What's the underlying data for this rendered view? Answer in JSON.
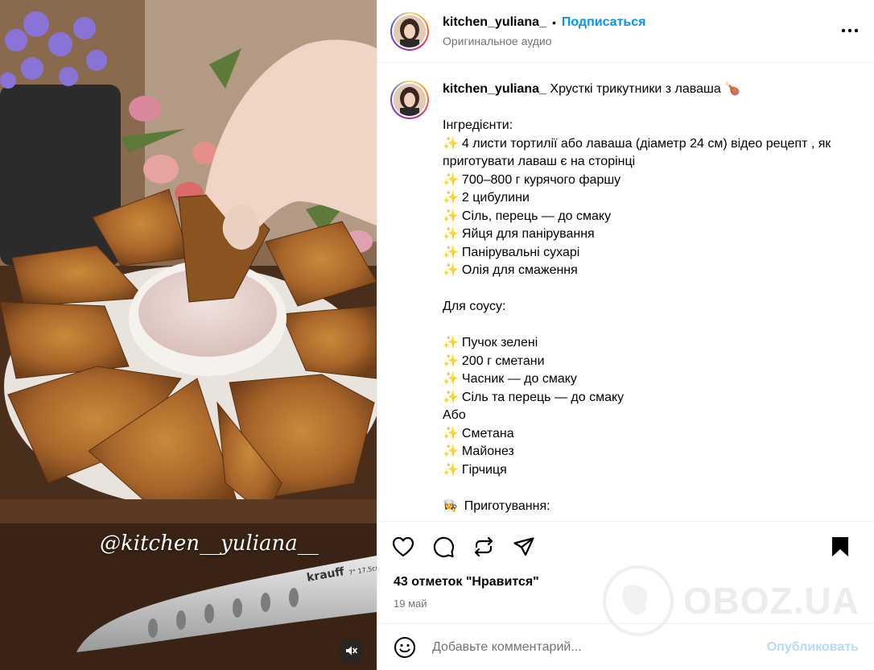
{
  "post": {
    "username": "kitchen_yuliana_",
    "separator": "•",
    "follow_label": "Подписаться",
    "audio_label": "Оригинальное аудио",
    "more_label": "•••"
  },
  "media": {
    "watermark": "@kitchen__yuliana__",
    "knife_brand": "krauff",
    "knife_marks": "7\" 17.5cm",
    "mute_icon": "speaker-muted-icon"
  },
  "caption": {
    "username": "kitchen_yuliana_",
    "title": "Хрусткі трикутники з лаваша",
    "title_emoji": "🍗",
    "sparkle": "✨",
    "chef_emoji": "👩‍🍳",
    "lines": [
      "",
      "Інгредієнти:",
      "4 листи тортилії або лаваша (діаметр 24 см) відео рецепт , як приготувати лаваш є на сторінці",
      "700–800 г курячого фаршу",
      "2 цибулини",
      "Сіль, перець — до смаку",
      "Яйця для панірування",
      "Панірувальні сухарі",
      "Олія для смаження",
      "",
      "Для соусу:",
      "",
      "Пучок зелені",
      "200 г сметани",
      "Часник — до смаку",
      "Сіль та перець — до смаку",
      "Або",
      "Сметана",
      "Майонез",
      "Гірчиця",
      "",
      "Приготування:"
    ]
  },
  "engagement": {
    "likes_label": "43 отметок \"Нравится\"",
    "date": "19 май"
  },
  "comment": {
    "placeholder": "Добавьте комментарий...",
    "publish_label": "Опубликовать"
  },
  "site_watermark": {
    "text": "OBOZ.UA"
  },
  "colors": {
    "accent_blue": "#0095f6",
    "publish_disabled": "#b3dbff",
    "secondary_text": "#737373",
    "divider": "#efefef"
  }
}
